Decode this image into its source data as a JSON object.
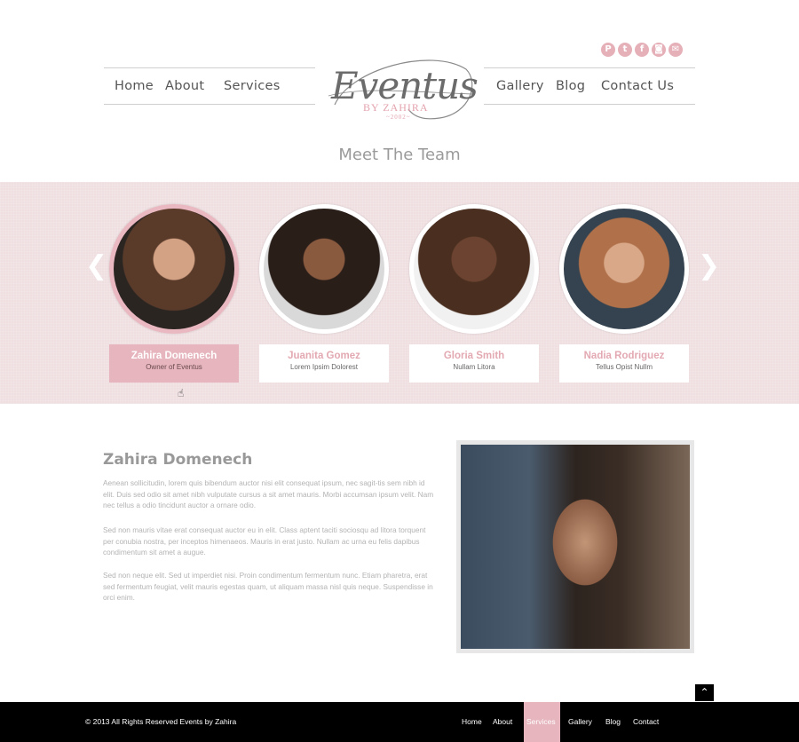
{
  "social": [
    {
      "icon": "pinterest-icon",
      "glyph": "P"
    },
    {
      "icon": "twitter-icon",
      "glyph": "t"
    },
    {
      "icon": "facebook-icon",
      "glyph": "f"
    },
    {
      "icon": "instagram-icon",
      "glyph": "◙"
    },
    {
      "icon": "email-icon",
      "glyph": "✉"
    }
  ],
  "nav": {
    "home": "Home",
    "about": "About",
    "services": "Services",
    "gallery": "Gallery",
    "blog": "Blog",
    "contact": "Contact Us"
  },
  "logo": {
    "script": "Eventus",
    "by": "BY ZAHIRA",
    "year": "~2002~"
  },
  "team": {
    "title": "Meet The Team",
    "prev_glyph": "❮",
    "next_glyph": "❯",
    "members": [
      {
        "name": "Zahira Domenech",
        "role": "Owner of Eventus",
        "photo_color": "#5a3b2a"
      },
      {
        "name": "Juanita Gomez",
        "role": "Lorem Ipsim Dolorest",
        "photo_color": "#4a3a30"
      },
      {
        "name": "Gloria Smith",
        "role": "Nullam Litora",
        "photo_color": "#6b4a35"
      },
      {
        "name": "Nadia Rodriguez",
        "role": "Tellus Opist Nullm",
        "photo_color": "#3d4b58"
      }
    ]
  },
  "bio": {
    "title": "Zahira Domenech",
    "paragraphs": [
      "Aenean sollicitudin, lorem quis bibendum auctor nisi elit consequat ipsum, nec sagit-tis sem nibh id elit. Duis sed odio sit amet nibh vulputate cursus a sit amet mauris. Morbi accumsan ipsum velit. Nam nec tellus a odio tincidunt auctor a ornare odio.",
      "Sed non  mauris vitae erat consequat auctor eu in elit. Class aptent taciti sociosqu ad litora torquent per conubia nostra, per inceptos himenaeos. Mauris in erat justo. Nullam ac urna eu felis dapibus condimentum sit amet a augue.",
      "Sed non neque elit. Sed ut imperdiet nisi. Proin condimentum fermentum nunc. Etiam pharetra, erat sed fermentum feugiat, velit mauris egestas quam, ut aliquam massa nisl quis neque. Suspendisse in orci enim."
    ]
  },
  "to_top_glyph": "⌃",
  "footer": {
    "copyright": "© 2013 All Rights Reserved Events by Zahira",
    "links": {
      "home": "Home",
      "about": "About",
      "services": "Services",
      "gallery": "Gallery",
      "blog": "Blog",
      "contact": "Contact"
    }
  },
  "colors": {
    "accent_pink": "#e6b5bd",
    "band_bg": "#efdfe1",
    "footer_bg": "#000000"
  }
}
